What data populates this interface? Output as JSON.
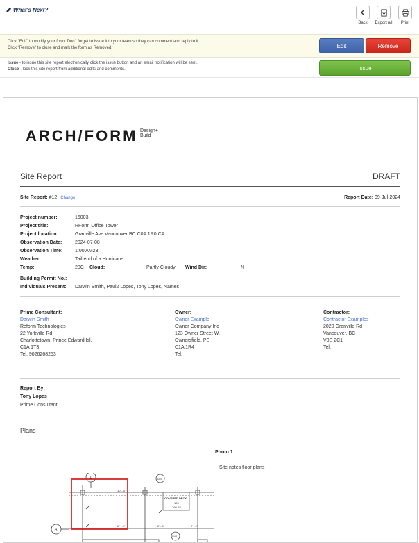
{
  "header": {
    "whats_next": "What's Next?",
    "back_label": "Back",
    "export_label": "Export all",
    "print_label": "Print"
  },
  "instructions": {
    "edit_text": "Click \"Edit\" to modify your form. Don't forget to issue it to your team so they can comment and reply to it.",
    "remove_text": "Click \"Remove\" to close and mark the form as Removed.",
    "issue_bold": "Issue",
    "issue_text": " - to issue this site report electronically click the issue button and an email notification will be sent.",
    "close_bold": "Close",
    "close_text": " - lock this site report from additional edits and comments."
  },
  "buttons": {
    "edit": "Edit",
    "remove": "Remove",
    "issue": "Issue"
  },
  "report": {
    "logo": "ARCH/FORM",
    "logo_sub1": "Design+",
    "logo_sub2": "Build",
    "title": "Site Report",
    "status": "DRAFT",
    "site_report_label": "Site Report:",
    "site_report_number": "#12",
    "change_link": "Change",
    "report_date_label": "Report Date:",
    "report_date": "09-Jul-2024",
    "fields": [
      {
        "label": "Project number:",
        "value": "16003"
      },
      {
        "label": "Project title:",
        "value": "RForm Office Tower"
      },
      {
        "label": "Project location",
        "value": "Granville Ave Vancouver BC C0A 1R0 CA"
      },
      {
        "label": "Observation Date:",
        "value": "2024-07-08"
      },
      {
        "label": "Observation Time:",
        "value": "1:00 AM23"
      },
      {
        "label": "Weather:",
        "value": "Tail end of a Hurricane"
      }
    ],
    "temp_label": "Temp:",
    "temp_value": "20C",
    "cloud_label": "Cloud:",
    "cloud_value": "Partly Cloudy",
    "wind_label": "Wind Dir:",
    "wind_value": "N",
    "permit_label": "Building Permit No.:",
    "present_label": "Individuals Present:",
    "present_value": "Darwin Smith, Paul2 Lopes, Tony Lopes, Names",
    "prime": {
      "heading": "Prime Consultant:",
      "name": "Darwin Smith",
      "lines": [
        "Reform Technologies",
        "22 Yorkville Rd",
        "Charlottetown, Prince Edward Isl.",
        "C1A 1T3",
        "Tel: 9026268253"
      ]
    },
    "owner": {
      "heading": "Owner:",
      "name": "Owner Example",
      "lines": [
        "Owner Company Inc",
        "123 Owner Street W.",
        "Ownersfield, PE",
        "C1A 1R4",
        "Tel:"
      ]
    },
    "contractor": {
      "heading": "Contractor:",
      "name": "Contractor Examples",
      "lines": [
        "2020 Granville Rd",
        "Vancouver, BC",
        "V0E 2C1",
        "Tel:"
      ]
    },
    "report_by_label": "Report By:",
    "report_by_name": "Tony Lopes",
    "report_by_role": "Prime Consultant",
    "section_plans": "Plans",
    "photo_label": "Photo 1",
    "photo_caption": "Site notes floor plans",
    "plan_text": {
      "covered_deck": "COVERED DECK",
      "room_number": "125",
      "area": "260 SF",
      "grid_1": "1",
      "grid_a": "A",
      "dim_1": "10' - 0\"",
      "dim_2": "11' - 0\"",
      "dim_3": "2' - 0\"",
      "dim_4": "2' - 0\"",
      "tag_a": "A2.0",
      "tag_b": "5/A4"
    }
  }
}
